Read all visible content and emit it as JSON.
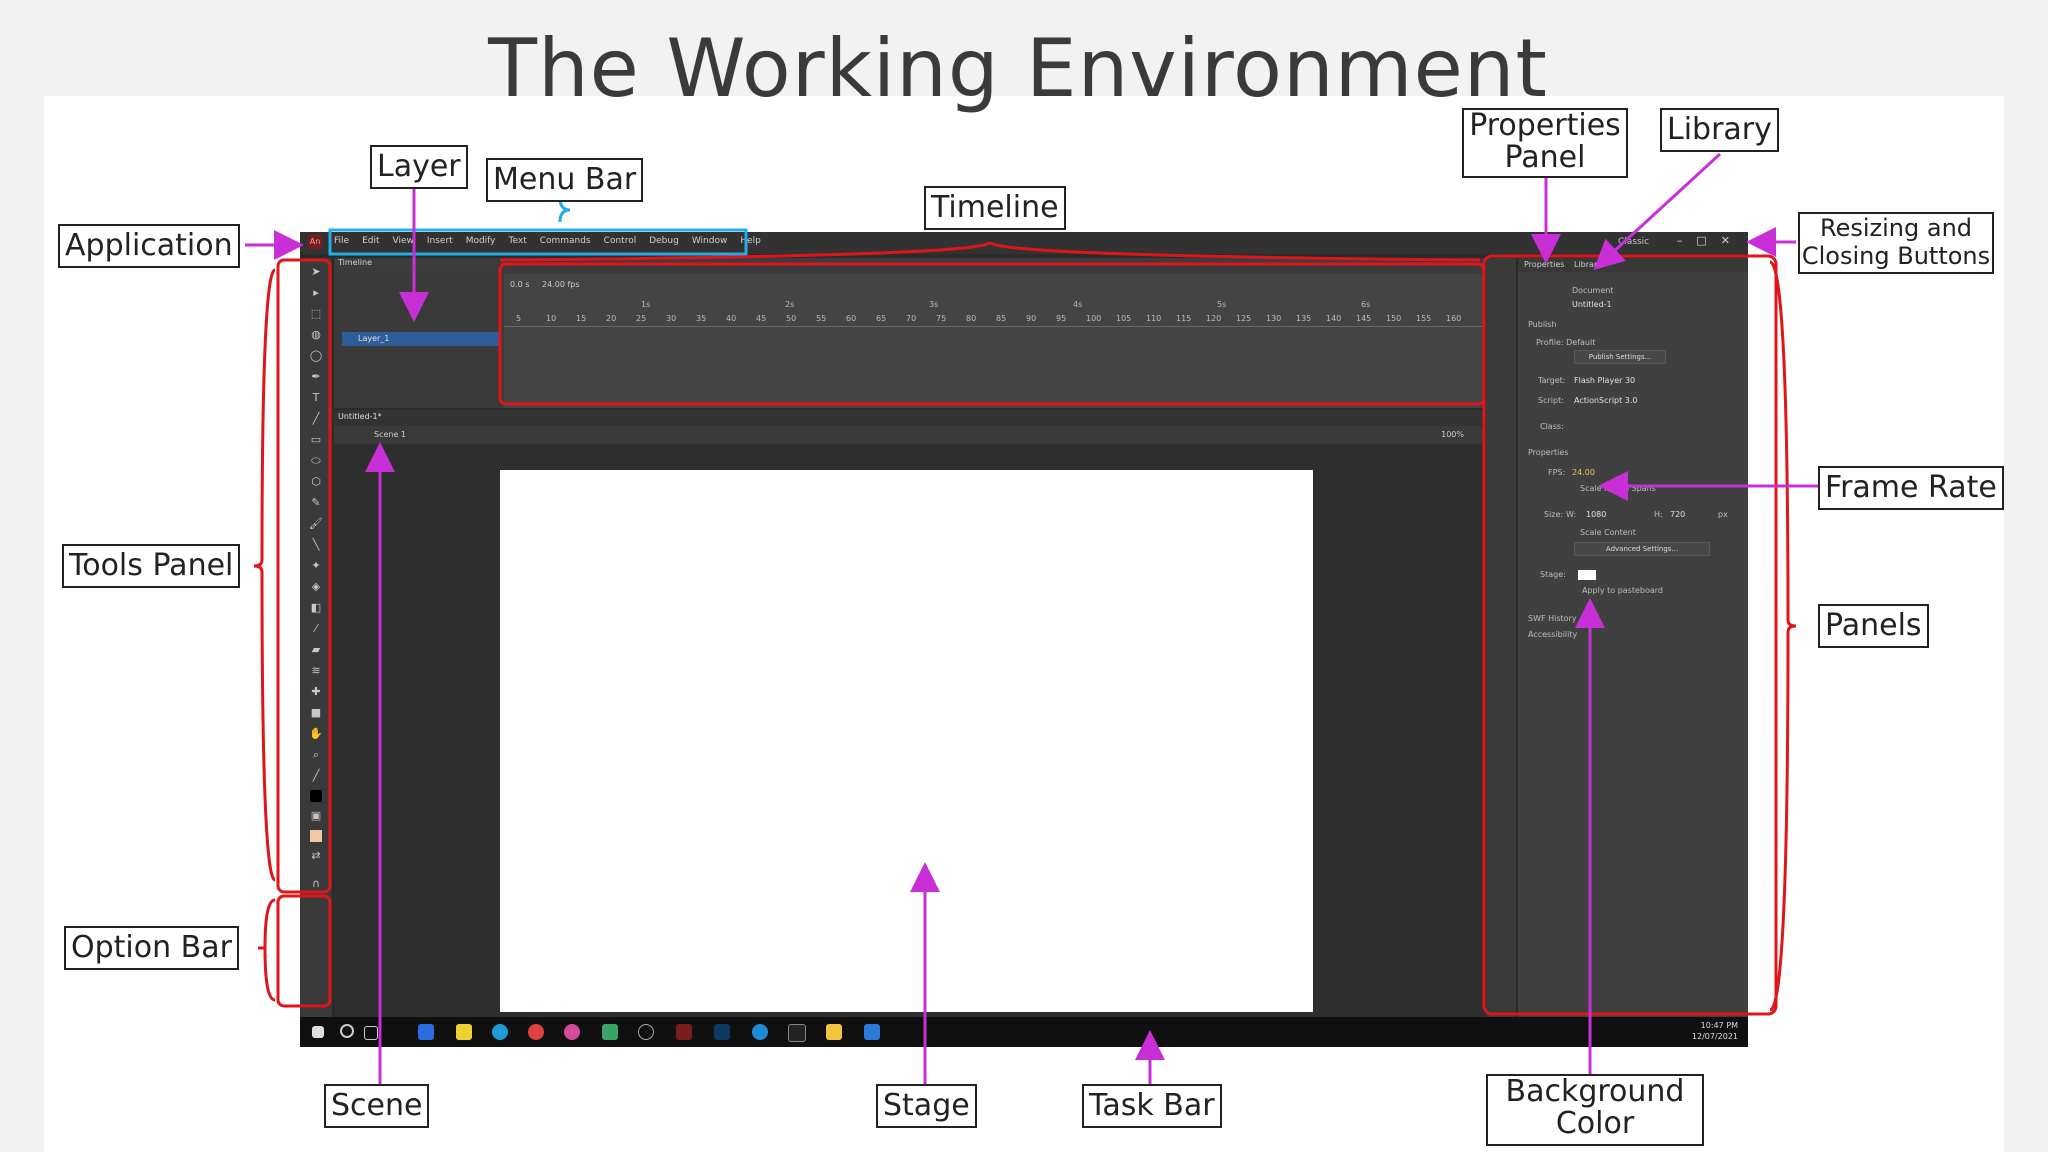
{
  "slide": {
    "title": "The Working Environment"
  },
  "app": {
    "logo": "An",
    "menu": [
      "File",
      "Edit",
      "View",
      "Insert",
      "Modify",
      "Text",
      "Commands",
      "Control",
      "Debug",
      "Window",
      "Help"
    ],
    "workspace": "Classic",
    "window_buttons": [
      "–",
      "□",
      "✕"
    ],
    "timeline": {
      "tab": "Timeline",
      "time": "0.0 s",
      "fps": "24.00 fps",
      "layer_name": "Layer_1",
      "ruler_frames": [
        "5",
        "10",
        "15",
        "20",
        "25",
        "30",
        "35",
        "40",
        "45",
        "50",
        "55",
        "60",
        "65",
        "70",
        "75",
        "80",
        "85",
        "90",
        "95",
        "100",
        "105",
        "110",
        "115",
        "120",
        "125",
        "130",
        "135",
        "140",
        "145",
        "150",
        "155",
        "160"
      ],
      "ruler_seconds": [
        "1s",
        "2s",
        "3s",
        "4s",
        "5s",
        "6s"
      ]
    },
    "document": {
      "tab": "Untitled-1*",
      "scene": "Scene 1",
      "zoom": "100%"
    },
    "panel": {
      "tabs": [
        "Properties",
        "Library"
      ],
      "doc_label": "Document",
      "doc_name": "Untitled-1",
      "publish_header": "Publish",
      "profile": "Profile: Default",
      "publish_settings_btn": "Publish Settings...",
      "target_label": "Target:",
      "target_value": "Flash Player 30",
      "script_label": "Script:",
      "script_value": "ActionScript 3.0",
      "class_label": "Class:",
      "properties_header": "Properties",
      "fps_label": "FPS:",
      "fps_value": "24.00",
      "scale_frame_spans": "Scale Frame Spans",
      "size_label": "Size:",
      "w_label": "W:",
      "w_value": "1080",
      "h_label": "H:",
      "h_value": "720",
      "px": "px",
      "scale_content": "Scale Content",
      "advanced_btn": "Advanced Settings...",
      "stage_label": "Stage:",
      "apply_pasteboard": "Apply to pasteboard",
      "swf_history": "SWF History",
      "accessibility": "Accessibility"
    },
    "taskbar": {
      "time": "10:47 PM",
      "date": "12/07/2021"
    }
  },
  "labels": {
    "application": "Application",
    "layer": "Layer",
    "menu_bar": "Menu Bar",
    "timeline": "Timeline",
    "properties_panel_1": "Properties",
    "properties_panel_2": "Panel",
    "library": "Library",
    "resizing_1": "Resizing and",
    "resizing_2": "Closing Buttons",
    "tools_panel": "Tools Panel",
    "frame_rate": "Frame Rate",
    "panels": "Panels",
    "option_bar": "Option Bar",
    "scene": "Scene",
    "stage": "Stage",
    "task_bar": "Task Bar",
    "background_color_1": "Background",
    "background_color_2": "Color"
  },
  "colors": {
    "highlight_red": "#e0151b",
    "highlight_blue": "#22aee6",
    "arrow_magenta": "#c92fd6"
  }
}
